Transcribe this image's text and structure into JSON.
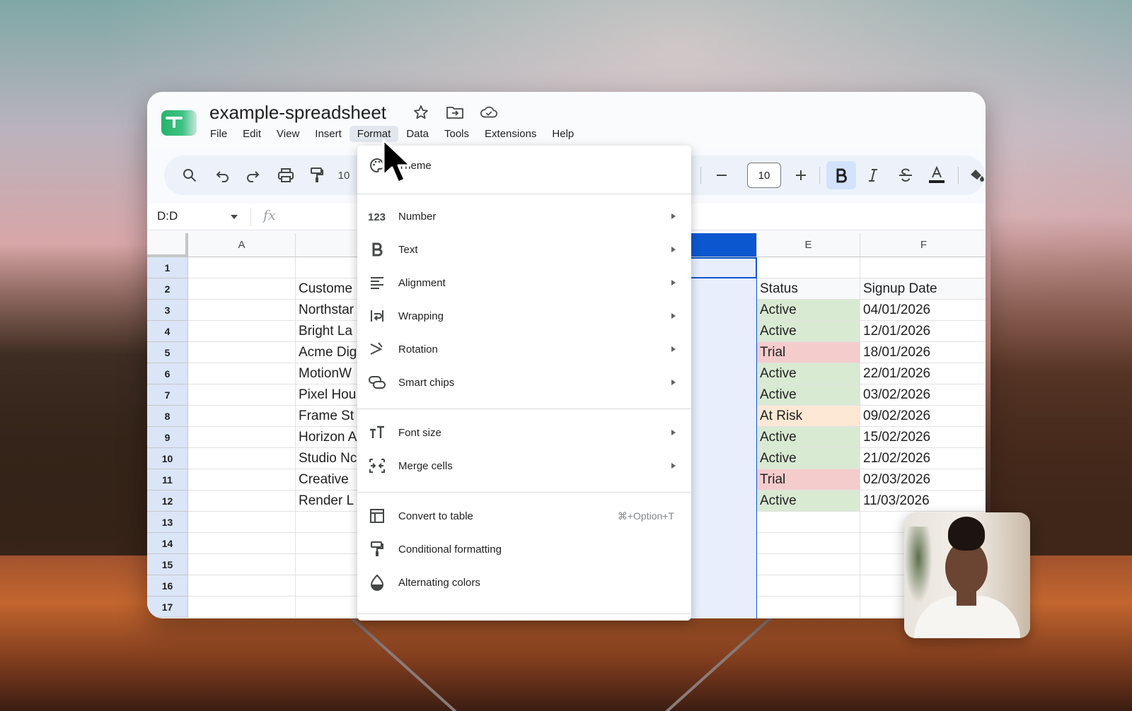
{
  "document": {
    "title": "example-spreadsheet"
  },
  "menubar": [
    "File",
    "Edit",
    "View",
    "Insert",
    "Format",
    "Data",
    "Tools",
    "Extensions",
    "Help"
  ],
  "menubar_active": "Format",
  "toolbar": {
    "font_size": "10",
    "partial_zoom": "10"
  },
  "formula_bar": {
    "name_box": "D:D",
    "fx_label": "fx"
  },
  "grid": {
    "columns": [
      "A",
      "",
      "",
      "",
      "E",
      "F"
    ],
    "rows": [
      "1",
      "2",
      "3",
      "4",
      "5",
      "6",
      "7",
      "8",
      "9",
      "10",
      "11",
      "12",
      "13",
      "14",
      "15",
      "16",
      "17"
    ],
    "column_b": [
      "",
      "Custome",
      "Northstar",
      "Bright La",
      "Acme Dig",
      "MotionW",
      "Pixel Hou",
      "Frame St",
      "Horizon A",
      "Studio Nc",
      "Creative",
      "Render L"
    ],
    "column_e": [
      "",
      "Status",
      "Active",
      "Active",
      "Trial",
      "Active",
      "Active",
      "At Risk",
      "Active",
      "Active",
      "Trial",
      "Active"
    ],
    "column_f": [
      "",
      "Signup Date",
      "04/01/2026",
      "12/01/2026",
      "18/01/2026",
      "22/01/2026",
      "03/02/2026",
      "09/02/2026",
      "15/02/2026",
      "21/02/2026",
      "02/03/2026",
      "11/03/2026"
    ],
    "status_colors": {
      "Active": "#d9ead3",
      "Trial": "#f4cccc",
      "At Risk": "#fce8d4"
    }
  },
  "format_menu": {
    "theme": "Theme",
    "items_group1": [
      {
        "label": "Number",
        "icon": "number-format-icon"
      },
      {
        "label": "Text",
        "icon": "bold-b-icon"
      },
      {
        "label": "Alignment",
        "icon": "align-left-icon"
      },
      {
        "label": "Wrapping",
        "icon": "wrap-text-icon"
      },
      {
        "label": "Rotation",
        "icon": "text-rotation-icon"
      },
      {
        "label": "Smart chips",
        "icon": "smart-chips-icon"
      }
    ],
    "items_group2": [
      {
        "label": "Font size",
        "icon": "font-size-icon"
      },
      {
        "label": "Merge cells",
        "icon": "merge-cells-icon"
      }
    ],
    "items_group3": [
      {
        "label": "Convert to table",
        "icon": "table-icon",
        "shortcut": "⌘+Option+T"
      },
      {
        "label": "Conditional formatting",
        "icon": "paint-roller-icon"
      },
      {
        "label": "Alternating colors",
        "icon": "color-drop-icon"
      }
    ]
  },
  "colors": {
    "accent": "#0b57d0",
    "row_header": "#dbe5f8",
    "selected_column": "#e8eefc",
    "toolbar_bg": "#edf2fa",
    "app_green": "#27b36a"
  }
}
